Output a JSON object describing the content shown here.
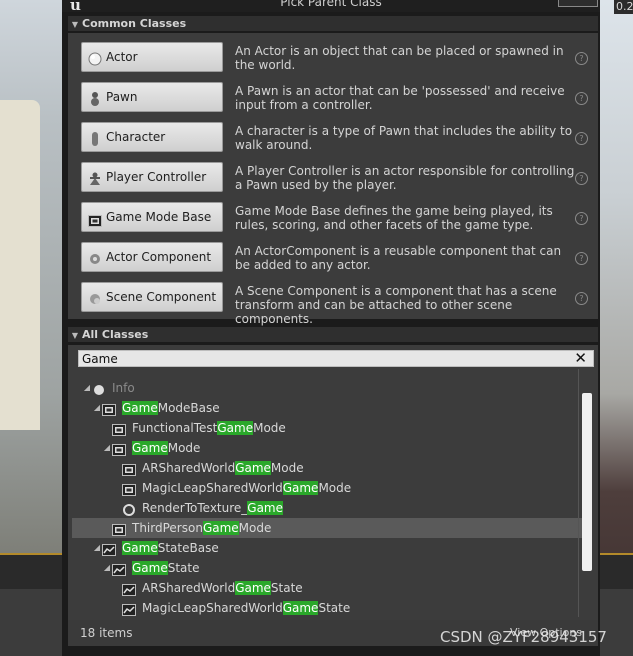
{
  "window": {
    "title": "Pick Parent Class",
    "speed": "0.2"
  },
  "common_classes": {
    "header": "Common Classes",
    "items": [
      {
        "label": "Actor",
        "desc": "An Actor is an object that can be placed or spawned in the world.",
        "icon": "actor-sphere-icon"
      },
      {
        "label": "Pawn",
        "desc": "A Pawn is an actor that can be 'possessed' and receive input from a controller.",
        "icon": "pawn-icon"
      },
      {
        "label": "Character",
        "desc": "A character is a type of Pawn that includes the ability to walk around.",
        "icon": "character-icon"
      },
      {
        "label": "Player Controller",
        "desc": "A Player Controller is an actor responsible for controlling a Pawn used by the player.",
        "icon": "controller-icon"
      },
      {
        "label": "Game Mode Base",
        "desc": "Game Mode Base defines the game being played, its rules, scoring, and other facets of the game type.",
        "icon": "game-mode-icon"
      },
      {
        "label": "Actor Component",
        "desc": "An ActorComponent is a reusable component that can be added to any actor.",
        "icon": "actor-component-icon"
      },
      {
        "label": "Scene Component",
        "desc": "A Scene Component is a component that has a scene transform and can be attached to other scene components.",
        "icon": "scene-component-icon"
      }
    ]
  },
  "all_classes": {
    "header": "All Classes",
    "search": {
      "value": "Game"
    },
    "tree": [
      {
        "pre": "Info",
        "match": "",
        "post": "",
        "depth": 1,
        "expanded": true,
        "icon": "info-sphere-icon",
        "dim": true
      },
      {
        "pre": "",
        "match": "Game",
        "post": "ModeBase",
        "depth": 2,
        "expanded": true,
        "icon": "game-mode-icon"
      },
      {
        "pre": "FunctionalTest",
        "match": "Game",
        "post": "Mode",
        "depth": 3,
        "expanded": false,
        "icon": "game-mode-icon"
      },
      {
        "pre": "",
        "match": "Game",
        "post": "Mode",
        "depth": 3,
        "expanded": true,
        "icon": "game-mode-icon"
      },
      {
        "pre": "ARSharedWorld",
        "match": "Game",
        "post": "Mode",
        "depth": 4,
        "expanded": false,
        "icon": "game-mode-icon"
      },
      {
        "pre": "MagicLeapSharedWorld",
        "match": "Game",
        "post": "Mode",
        "depth": 4,
        "expanded": false,
        "icon": "game-mode-icon"
      },
      {
        "pre": "RenderToTexture_",
        "match": "Game",
        "post": "",
        "depth": 4,
        "expanded": false,
        "icon": "circle-icon"
      },
      {
        "pre": "ThirdPerson",
        "match": "Game",
        "post": "Mode",
        "depth": 3,
        "expanded": false,
        "icon": "game-mode-icon",
        "selected": true
      },
      {
        "pre": "",
        "match": "Game",
        "post": "StateBase",
        "depth": 2,
        "expanded": true,
        "icon": "game-state-icon"
      },
      {
        "pre": "",
        "match": "Game",
        "post": "State",
        "depth": 3,
        "expanded": true,
        "icon": "game-state-icon"
      },
      {
        "pre": "ARSharedWorld",
        "match": "Game",
        "post": "State",
        "depth": 4,
        "expanded": false,
        "icon": "game-state-icon"
      },
      {
        "pre": "MagicLeapSharedWorld",
        "match": "Game",
        "post": "State",
        "depth": 4,
        "expanded": false,
        "icon": "game-state-icon"
      }
    ],
    "item_count": "18 items",
    "view_options": "View Options"
  },
  "watermark": "CSDN @ZYF28943157"
}
